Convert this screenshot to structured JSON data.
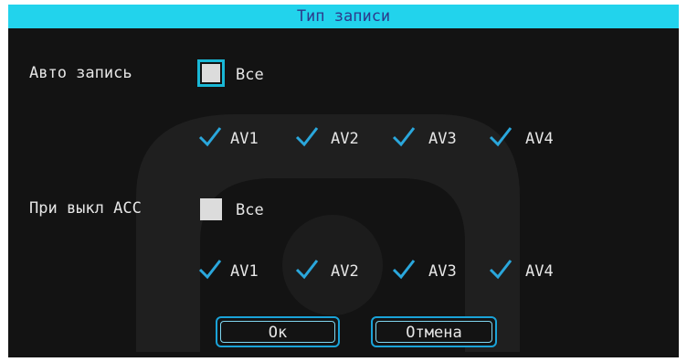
{
  "dialog": {
    "title": "Тип записи"
  },
  "auto_record": {
    "label": "Авто запись",
    "all_label": "Все",
    "channels": [
      "AV1",
      "AV2",
      "AV3",
      "AV4"
    ]
  },
  "acc_off": {
    "label": "При выкл ACC",
    "all_label": "Все",
    "channels": [
      "AV1",
      "AV2",
      "AV3",
      "AV4"
    ]
  },
  "buttons": {
    "ok": "Ок",
    "cancel": "Отмена"
  },
  "colors": {
    "title_bar": "#22d3ec",
    "title_text": "#2d3a8c",
    "background": "#131313",
    "focus_border": "#19b7d6",
    "check": "#2aa7dc",
    "checkbox_fill": "#dcdcdc"
  },
  "icons": {
    "check": "check-icon",
    "watermark": "logo-watermark-icon"
  }
}
